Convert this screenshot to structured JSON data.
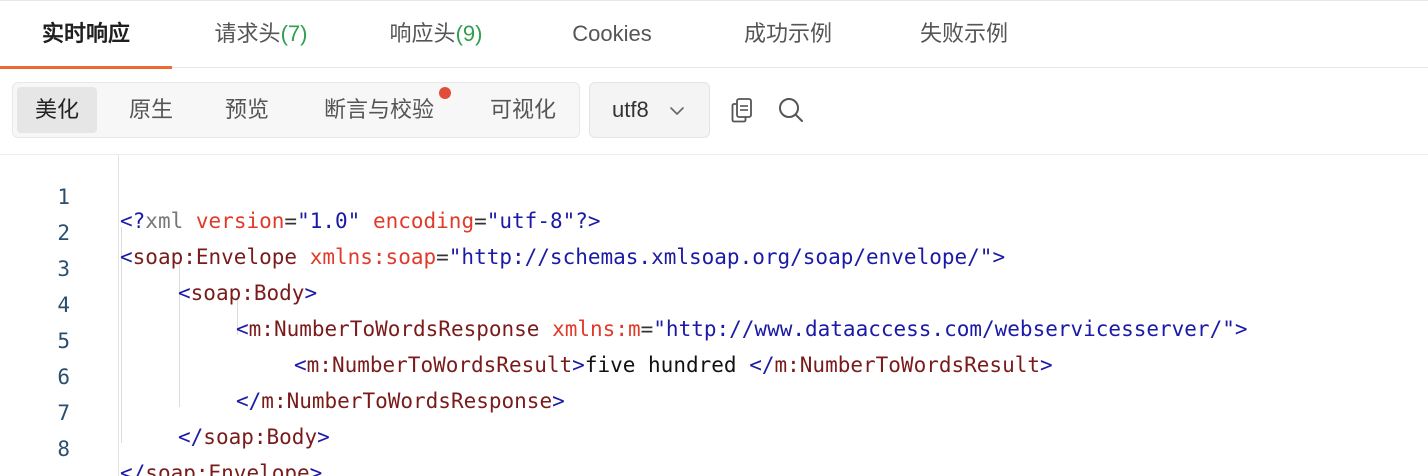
{
  "tabs": [
    {
      "label": "实时响应",
      "count": "",
      "active": true
    },
    {
      "label": "请求头",
      "count": "(7)",
      "active": false
    },
    {
      "label": "响应头",
      "count": "(9)",
      "active": false
    },
    {
      "label": "Cookies",
      "count": "",
      "active": false
    },
    {
      "label": "成功示例",
      "count": "",
      "active": false
    },
    {
      "label": "失败示例",
      "count": "",
      "active": false
    }
  ],
  "view_modes": [
    {
      "label": "美化",
      "active": true
    },
    {
      "label": "原生",
      "active": false
    },
    {
      "label": "预览",
      "active": false
    },
    {
      "label": "断言与校验",
      "active": false,
      "badge": true
    },
    {
      "label": "可视化",
      "active": false
    }
  ],
  "encoding": {
    "value": "utf8",
    "icon": "chevron-down-icon"
  },
  "tools": {
    "copy_icon": "copy-icon",
    "search_icon": "search-icon"
  },
  "colors": {
    "accent": "#ef6a33",
    "count": "#2e9f4f",
    "badge": "#e24d3a"
  },
  "code": {
    "line_numbers": [
      "1",
      "2",
      "3",
      "4",
      "5",
      "6",
      "7",
      "8"
    ],
    "l1": {
      "open": "<?",
      "pi": "xml",
      "a1": "version",
      "eq": "=",
      "v1": "\"1.0\"",
      "a2": "encoding",
      "v2": "\"utf-8\"",
      "close": "?>"
    },
    "l2": {
      "open": "<",
      "tag": "soap:Envelope",
      "attr": "xmlns:soap",
      "eq": "=",
      "val": "\"http://schemas.xmlsoap.org/soap/envelope/\"",
      "close": ">"
    },
    "l3": {
      "open": "<",
      "tag": "soap:Body",
      "close": ">"
    },
    "l4": {
      "open": "<",
      "tag": "m:NumberToWordsResponse",
      "attr": "xmlns:m",
      "eq": "=",
      "val": "\"http://www.dataaccess.com/webservicesserver/\"",
      "close": ">"
    },
    "l5": {
      "open": "<",
      "tag": "m:NumberToWordsResult",
      "close": ">",
      "text": "five hundred ",
      "end_open": "</",
      "end_tag": "m:NumberToWordsResult",
      "end_close": ">"
    },
    "l6": {
      "open": "</",
      "tag": "m:NumberToWordsResponse",
      "close": ">"
    },
    "l7": {
      "open": "</",
      "tag": "soap:Body",
      "close": ">"
    },
    "l8": {
      "open": "</",
      "tag": "soap:Envelope",
      "close": ">"
    }
  }
}
